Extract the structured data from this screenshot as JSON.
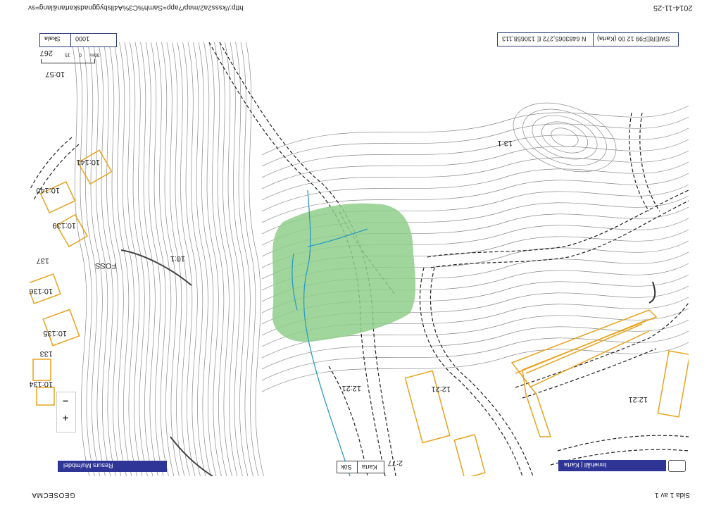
{
  "header": {
    "url": "http://ksss2a2/map/?app=Samh%C3%A4llsbyggnadskartan&lang=sv",
    "date": "2014-11-25"
  },
  "footer": {
    "brand": "GEOSECMA",
    "page": "Sida 1 av 1"
  },
  "scale_control": {
    "label": "Skala",
    "value": "1000",
    "ruler_labels": [
      "0",
      "15",
      "30m"
    ]
  },
  "coordinates": {
    "text": "N 6483065,272 E 130658,113",
    "crs": "SWEREF99 12 00 (Karta)"
  },
  "buttons": {
    "search": "Sök",
    "map": "Karta"
  },
  "panels": {
    "left_bar": "Resurs Mu/mbdel",
    "right_bar": "Innehåll | Karta"
  },
  "zoom": {
    "in": "+",
    "out": "−"
  },
  "map_labels": [
    {
      "id": "parcel-10-57",
      "text": "10:57"
    },
    {
      "id": "parcel-267",
      "text": "267"
    },
    {
      "id": "parcel-10-141",
      "text": "10:141"
    },
    {
      "id": "parcel-10-140",
      "text": "10:140"
    },
    {
      "id": "parcel-10-139",
      "text": "10:139"
    },
    {
      "id": "parcel-10-1",
      "text": "10:1"
    },
    {
      "id": "place-foss",
      "text": "FOSS"
    },
    {
      "id": "parcel-137",
      "text": "137"
    },
    {
      "id": "parcel-10-136",
      "text": "10:136"
    },
    {
      "id": "parcel-10-135",
      "text": "10:135"
    },
    {
      "id": "parcel-133",
      "text": "133"
    },
    {
      "id": "parcel-10-134",
      "text": "10:134"
    },
    {
      "id": "parcel-13-1",
      "text": "13:1"
    },
    {
      "id": "parcel-12-21-a",
      "text": "12:21"
    },
    {
      "id": "parcel-12-21-b",
      "text": "12:21"
    },
    {
      "id": "parcel-12-21-c",
      "text": "12:21"
    },
    {
      "id": "parcel-2-77",
      "text": "2:77"
    }
  ],
  "colors": {
    "highlight_area": "#8fcf8a",
    "buildings": "#e8a31d",
    "water": "#2b9bc6",
    "panel": "#2e3596",
    "contour": "#8a8a8a"
  }
}
